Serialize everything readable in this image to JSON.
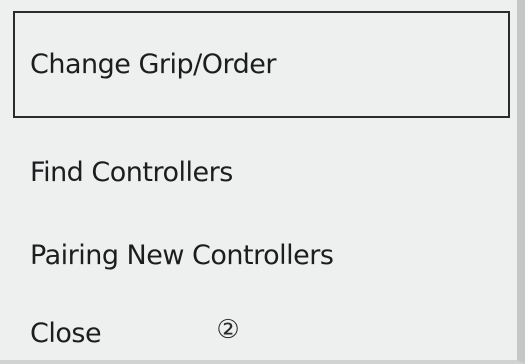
{
  "menu": {
    "items": [
      {
        "label": "Change Grip/Order",
        "selected": true
      },
      {
        "label": "Find Controllers",
        "selected": false
      },
      {
        "label": "Pairing New Controllers",
        "selected": false
      },
      {
        "label": "Close",
        "selected": false
      }
    ],
    "close_button_hint": "②"
  }
}
